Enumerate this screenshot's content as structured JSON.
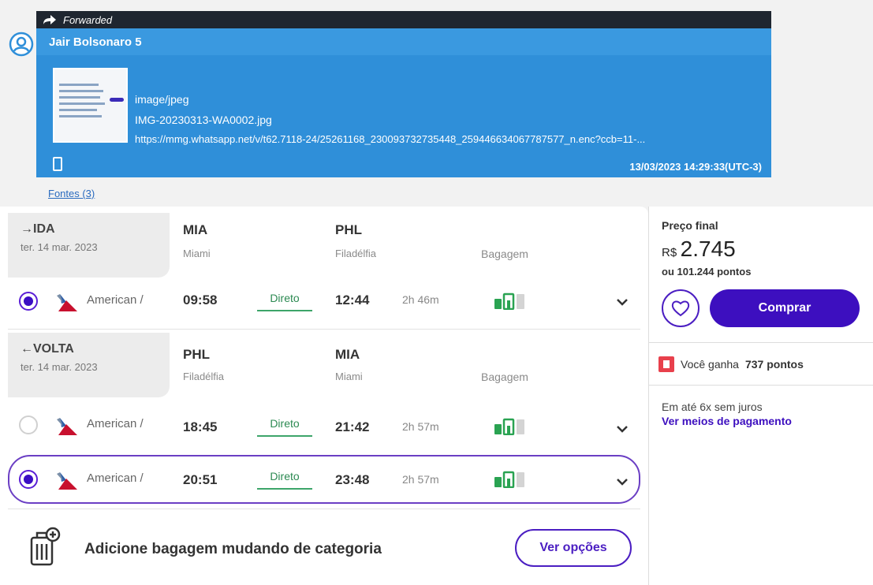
{
  "message": {
    "forwarded_label": "Forwarded",
    "sender": "Jair Bolsonaro 5",
    "mime": "image/jpeg",
    "filename": "IMG-20230313-WA0002.jpg",
    "url": "https://mmg.whatsapp.net/v/t62.7118-24/25261168_230093732735448_259446634067787577_n.enc?ccb=11-...",
    "timestamp": "13/03/2023 14:29:33(UTC-3)",
    "sources_link": "Fontes (3)"
  },
  "outbound": {
    "title": "→IDA",
    "date": "ter. 14 mar. 2023",
    "origin_code": "MIA",
    "origin_city": "Miami",
    "dest_code": "PHL",
    "dest_city": "Filadélfia",
    "baggage_label": "Bagagem",
    "flights": [
      {
        "airline": "American /",
        "depart": "09:58",
        "stops": "Direto",
        "arrive": "12:44",
        "duration": "2h 46m",
        "selected": true
      }
    ]
  },
  "inbound": {
    "title": "←VOLTA",
    "date": "ter. 14 mar. 2023",
    "origin_code": "PHL",
    "origin_city": "Filadélfia",
    "dest_code": "MIA",
    "dest_city": "Miami",
    "baggage_label": "Bagagem",
    "flights": [
      {
        "airline": "American /",
        "depart": "18:45",
        "stops": "Direto",
        "arrive": "21:42",
        "duration": "2h 57m",
        "selected": false
      },
      {
        "airline": "American /",
        "depart": "20:51",
        "stops": "Direto",
        "arrive": "23:48",
        "duration": "2h 57m",
        "selected": true
      }
    ]
  },
  "footer": {
    "add_baggage_text": "Adicione bagagem mudando de categoria",
    "options_button": "Ver opções"
  },
  "pricing": {
    "label": "Preço final",
    "currency": "R$",
    "value": "2.745",
    "points_alt": "ou 101.244 pontos",
    "buy_button": "Comprar",
    "earn_prefix": "Você ganha",
    "earn_points": "737 pontos",
    "installments": "Em até 6x sem juros",
    "payment_link": "Ver meios de pagamento"
  },
  "colors": {
    "whatsapp_blue": "#2f8fd9",
    "brand_purple": "#3d0fbf",
    "direct_green": "#2c8a52",
    "bag_green": "#2aa352"
  },
  "icons": [
    "forward-arrow-icon",
    "user-avatar-icon",
    "phone-icon",
    "american-airlines-logo",
    "carry-on-bag-icon",
    "checked-bag-icon",
    "chevron-down-icon",
    "luggage-add-icon",
    "heart-icon",
    "points-badge-icon"
  ]
}
